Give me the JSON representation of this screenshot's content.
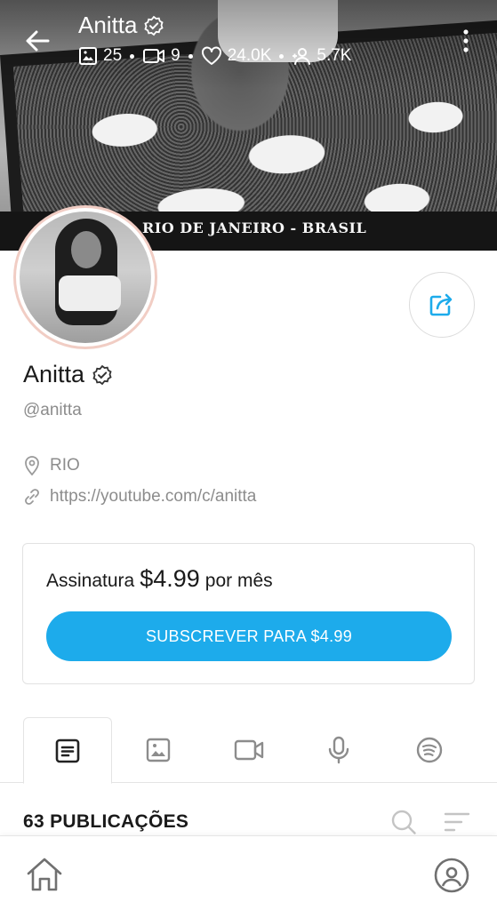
{
  "header": {
    "title": "Anitta",
    "stats": {
      "photos": "25",
      "videos": "9",
      "likes": "24.0K",
      "fans": "5.7K"
    },
    "cover_banner_text": "RIO DE JANEIRO - BRASIL"
  },
  "profile": {
    "name": "Anitta",
    "handle": "@anitta",
    "location": "RIO",
    "website": "https://youtube.com/c/anitta"
  },
  "subscription": {
    "label": "Assinatura",
    "price": "$4.99",
    "period": "por mês",
    "button_label": "SUBSCREVER PARA $4.99"
  },
  "feed": {
    "count_label": "63 PUBLICAÇÕES"
  },
  "colors": {
    "accent": "#1dabeb",
    "muted_text": "#8c8c8c",
    "avatar_ring": "#f1cdc4"
  },
  "icons": {
    "tabs": [
      "posts-icon",
      "photos-icon",
      "videos-icon",
      "audio-icon",
      "spotify-icon"
    ],
    "bottom_nav": [
      "home-icon",
      "profile-icon"
    ]
  }
}
